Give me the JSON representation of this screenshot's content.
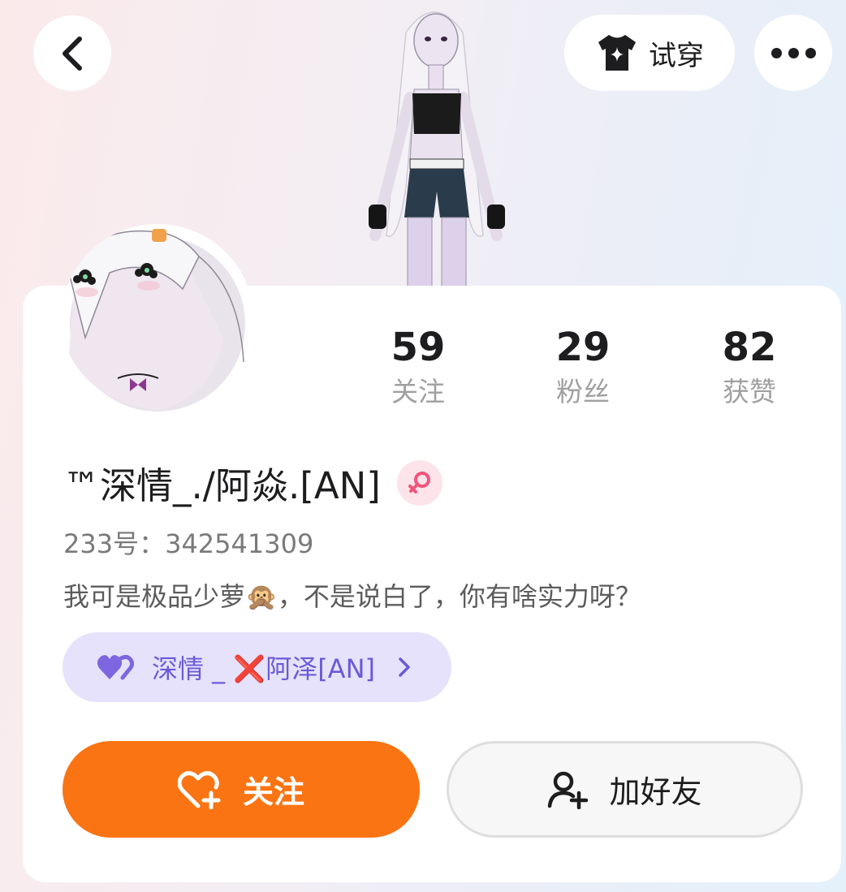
{
  "header": {
    "tryon_label": "试穿",
    "colors": {
      "button_bg": "#ffffff",
      "icon": "#1d1d1f"
    }
  },
  "stats": [
    {
      "value": "59",
      "label": "关注"
    },
    {
      "value": "29",
      "label": "粉丝"
    },
    {
      "value": "82",
      "label": "获赞"
    }
  ],
  "profile": {
    "nickname": "™深情_./阿焱.[AN]",
    "gender": "female",
    "uid_line": "233号：342541309",
    "bio": "我可是极品少萝🙊，不是说白了，你有啥实力呀？"
  },
  "cp_tag": {
    "label": "深情 _ ❌阿泽[AN]",
    "color": "#6b5ad9",
    "bg": "#e6e2fb"
  },
  "actions": {
    "follow_label": "关注",
    "add_friend_label": "加好友",
    "follow_color": "#fb7413"
  }
}
